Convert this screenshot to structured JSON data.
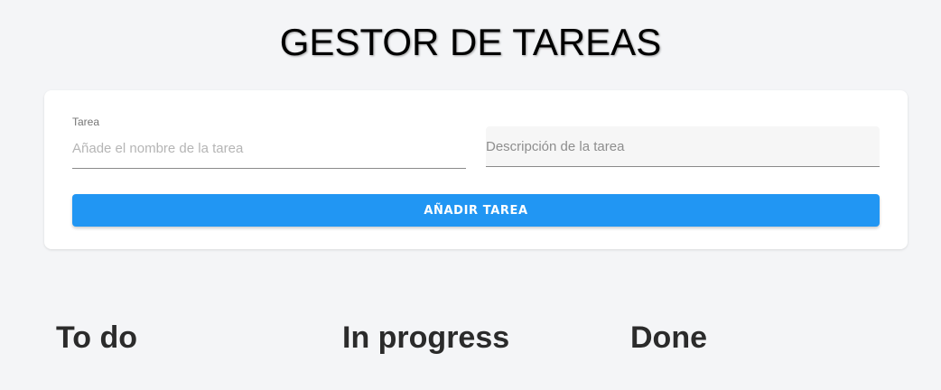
{
  "header": {
    "title": "GESTOR DE TAREAS"
  },
  "form": {
    "name_field": {
      "label": "Tarea",
      "placeholder": "Añade el nombre de la tarea",
      "value": ""
    },
    "description_field": {
      "placeholder": "Descripción de la tarea",
      "value": ""
    },
    "submit_label": "AÑADIR TAREA"
  },
  "columns": [
    {
      "title": "To do"
    },
    {
      "title": "In progress"
    },
    {
      "title": "Done"
    }
  ],
  "colors": {
    "background": "#f4f5f7",
    "card": "#ffffff",
    "accent": "#2196f3",
    "heading_text": "#2b2b2b"
  }
}
